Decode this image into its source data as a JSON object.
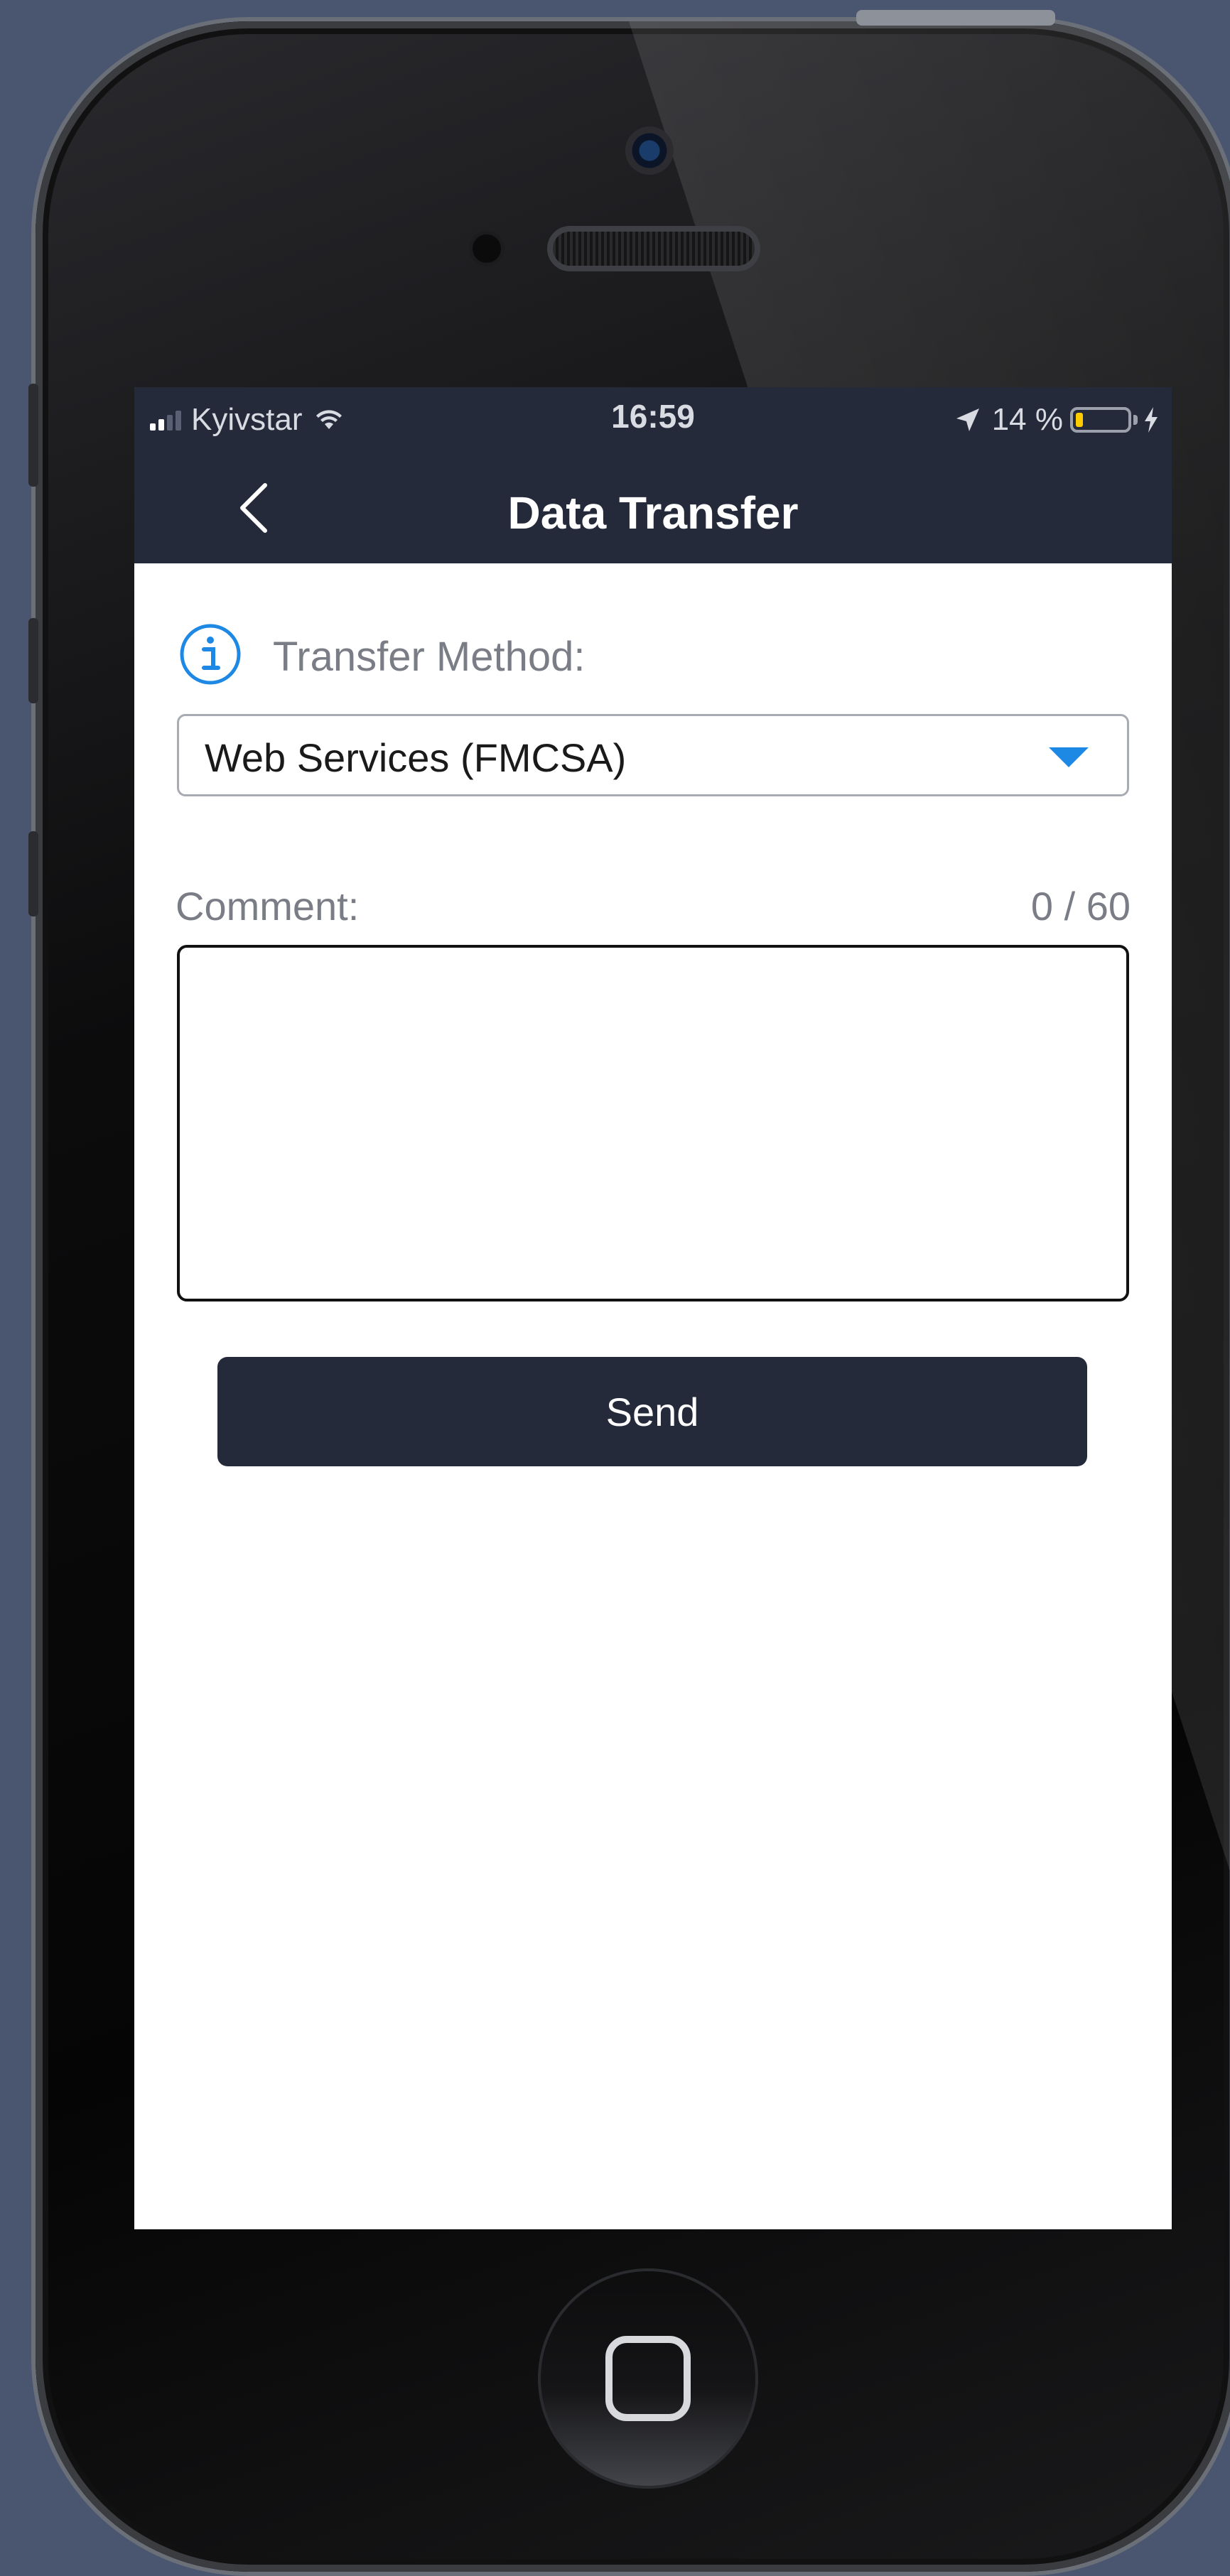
{
  "status_bar": {
    "carrier": "Kyivstar",
    "time": "16:59",
    "battery_percent": "14 %",
    "battery_level": 0.14
  },
  "nav": {
    "title": "Data Transfer"
  },
  "form": {
    "method_label": "Transfer Method:",
    "method_value": "Web Services (FMCSA)",
    "comment_label": "Comment:",
    "comment_counter": "0 / 60",
    "comment_value": "",
    "send_label": "Send"
  },
  "colors": {
    "nav_background": "#252a3a",
    "accent": "#1e88e5",
    "battery": "#ffcc00",
    "backdrop": "#4a5670"
  },
  "icons": {
    "back": "chevron-left-icon",
    "info": "info-icon",
    "dropdown": "caret-down-icon",
    "wifi": "wifi-icon",
    "location": "location-arrow-icon",
    "charging": "bolt-icon"
  }
}
